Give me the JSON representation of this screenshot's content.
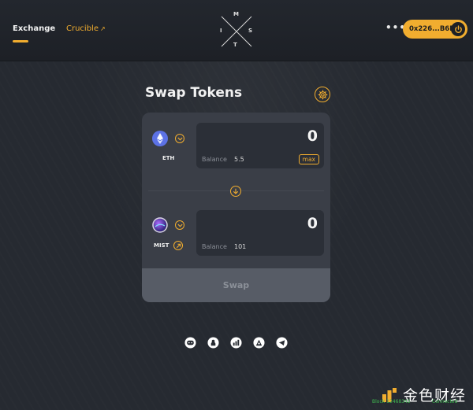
{
  "header": {
    "nav": {
      "exchange_label": "Exchange",
      "crucible_label": "Crucible",
      "crucible_ext_icon": "external-link-icon"
    },
    "logo_letters": {
      "top": "M",
      "left": "I",
      "right": "S",
      "bottom": "T"
    },
    "more_icon": "more-dots-icon",
    "more_glyph": "•••",
    "wallet": {
      "address": "0x226...B6E",
      "icon": "power-icon"
    }
  },
  "swap": {
    "title": "Swap Tokens",
    "settings_icon": "gear-icon",
    "from": {
      "symbol": "ETH",
      "icon": "eth-token-icon",
      "amount": "0",
      "balance_label": "Balance",
      "balance_value": "5.5",
      "max_label": "max"
    },
    "direction_icon": "arrow-down-icon",
    "to": {
      "symbol": "MIST",
      "icon": "mist-token-icon",
      "link_icon": "external-link-icon",
      "amount": "0",
      "balance_label": "Balance",
      "balance_value": "101"
    },
    "swap_label": "Swap"
  },
  "socials": [
    "discord-icon",
    "github-icon",
    "chart-icon",
    "rocket-icon",
    "telegram-icon"
  ],
  "footer": {
    "block_text": "Block 12468342",
    "connection_text": "Connected"
  },
  "watermark": {
    "text": "金色财经"
  },
  "colors": {
    "accent": "#f1ad2f",
    "background": "#262a31",
    "card": "#3a3e47",
    "input_bg": "#2b2f37",
    "swap_button": "#575c66",
    "status_green": "#3fb950"
  }
}
